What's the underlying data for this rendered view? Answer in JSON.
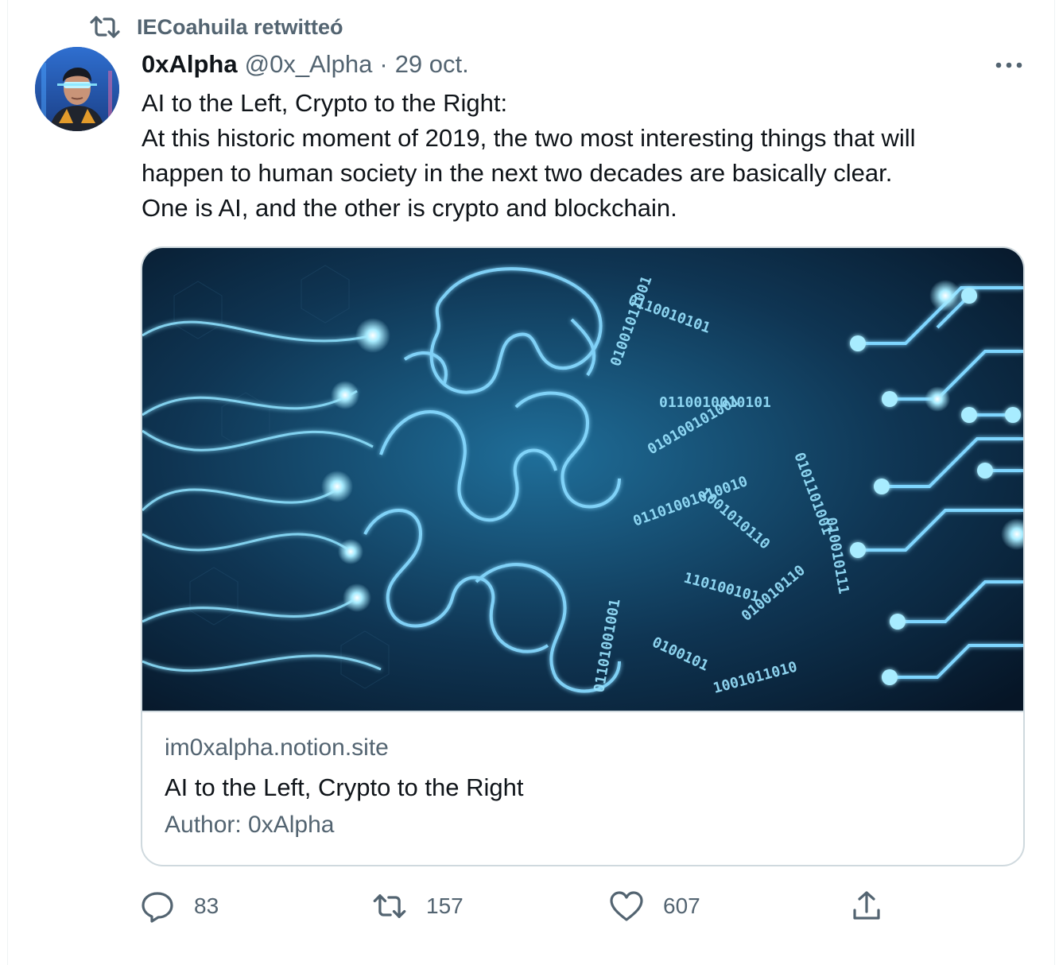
{
  "retweet": {
    "label": "IECoahuila retwitteó"
  },
  "tweet": {
    "display_name": "0xAlpha",
    "handle": "@0x_Alpha",
    "separator": "·",
    "date": "29 oct.",
    "text_lines": [
      "AI to the Left, Crypto to the Right:",
      "At this historic moment of 2019, the two most interesting things that will",
      "happen to human society in the next two decades are basically clear.",
      "One is AI, and the other is crypto and blockchain."
    ]
  },
  "card": {
    "domain": "im0xalpha.notion.site",
    "title": "AI to the Left, Crypto to the Right",
    "description": "Author: 0xAlpha"
  },
  "actions": {
    "replies": "83",
    "retweets": "157",
    "likes": "607"
  },
  "icons": {
    "retweet_indicator": "retweet-icon",
    "more": "more-icon",
    "reply": "reply-icon",
    "retweet": "retweet-icon",
    "like": "heart-icon",
    "share": "share-icon"
  },
  "colors": {
    "primary_text": "#0f1419",
    "secondary_text": "#536471",
    "border": "#cfd9de",
    "image_glow": "#7fd6ff"
  }
}
